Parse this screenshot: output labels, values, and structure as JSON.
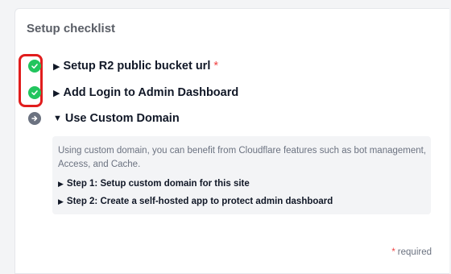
{
  "checklist": {
    "title": "Setup checklist",
    "items": [
      {
        "label": "Setup R2 public bucket url",
        "required_mark": "*",
        "status": "done",
        "icon": "check-circle-icon",
        "expanded": false
      },
      {
        "label": "Add Login to Admin Dashboard",
        "status": "done",
        "icon": "check-circle-icon",
        "expanded": false
      },
      {
        "label": "Use Custom Domain",
        "status": "next",
        "icon": "arrow-right-circle-icon",
        "expanded": true
      }
    ],
    "custom_domain": {
      "description": "Using custom domain, you can benefit from Cloudflare features such as bot management, Access, and Cache.",
      "steps": [
        {
          "label": "Step 1: Setup custom domain for this site"
        },
        {
          "label": "Step 2: Create a self-hosted app to protect admin dashboard"
        }
      ]
    },
    "footnote": {
      "mark": "*",
      "text": "required"
    }
  },
  "colors": {
    "done": "#22c55e",
    "next": "#6b7280",
    "required": "#ef4444",
    "highlight": "#e11d1d"
  }
}
